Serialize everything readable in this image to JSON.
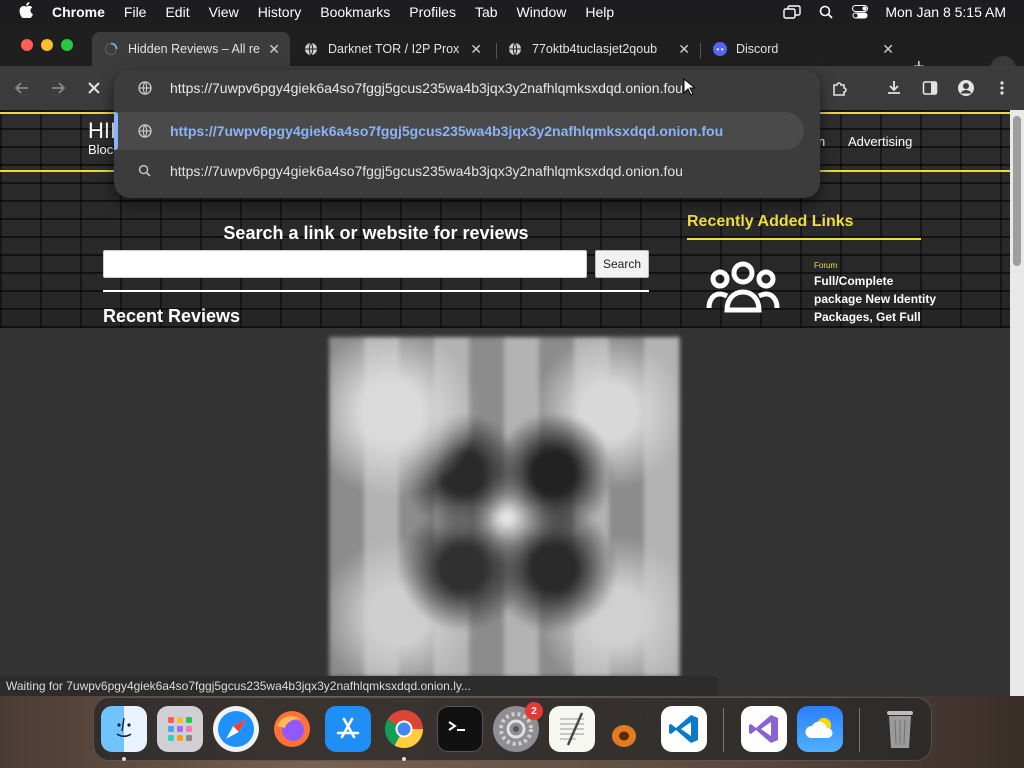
{
  "menubar": {
    "app_name": "Chrome",
    "menus": [
      "File",
      "Edit",
      "View",
      "History",
      "Bookmarks",
      "Profiles",
      "Tab",
      "Window",
      "Help"
    ],
    "clock": "Mon Jan 8  5:15 AM"
  },
  "tabs": [
    {
      "title": "Hidden Reviews – All re",
      "icon": "loading-spinner-icon",
      "active": true
    },
    {
      "title": "Darknet TOR / I2P Prox",
      "icon": "globe-icon",
      "active": false
    },
    {
      "title": "77oktb4tuclasjet2qoub",
      "icon": "globe-icon",
      "active": false
    },
    {
      "title": "Discord",
      "icon": "discord-icon",
      "active": false
    }
  ],
  "omnibox": {
    "typed_url": "https://7uwpv6pgy4giek6a4so7fggj5gcus235wa4b3jqx3y2nafhlqmksxdqd.onion.fou",
    "suggestions": [
      {
        "text": "https://7uwpv6pgy4giek6a4so7fggj5gcus235wa4b3jqx3y2nafhlqmksxdqd.onion.fou",
        "icon": "globe-icon",
        "selected": true
      },
      {
        "text": "https://7uwpv6pgy4giek6a4so7fggj5gcus235wa4b3jqx3y2nafhlqmksxdqd.onion.fou",
        "icon": "search-icon",
        "selected": false
      }
    ]
  },
  "page": {
    "logo_text": "HII",
    "logo_sub": "Bloc",
    "nav_links": [
      "n",
      "Advertising"
    ],
    "search_heading": "Search a link or website for reviews",
    "search_placeholder": "",
    "search_button": "Search",
    "recent_reviews_heading": "Recent Reviews",
    "recent_links_heading": "Recently Added Links",
    "recent_link": {
      "category": "Forum",
      "title": "Full/Complete package New Identity Packages, Get Full"
    }
  },
  "status_text": "Waiting for 7uwpv6pgy4giek6a4so7fggj5gcus235wa4b3jqx3y2nafhlqmksxdqd.onion.ly...",
  "dock": {
    "apps": [
      "Finder",
      "Launchpad",
      "Safari",
      "Firefox",
      "App Store",
      "Chrome",
      "Terminal",
      "System Settings",
      "TextEdit",
      "GarageBand",
      "VS Code",
      "Visual Studio",
      "Weather",
      "Trash"
    ],
    "settings_badge": "2"
  },
  "colors": {
    "accent_yellow": "#f0de3c",
    "link_blue": "#8ab4f8",
    "toolbar": "#3c3c3c"
  }
}
